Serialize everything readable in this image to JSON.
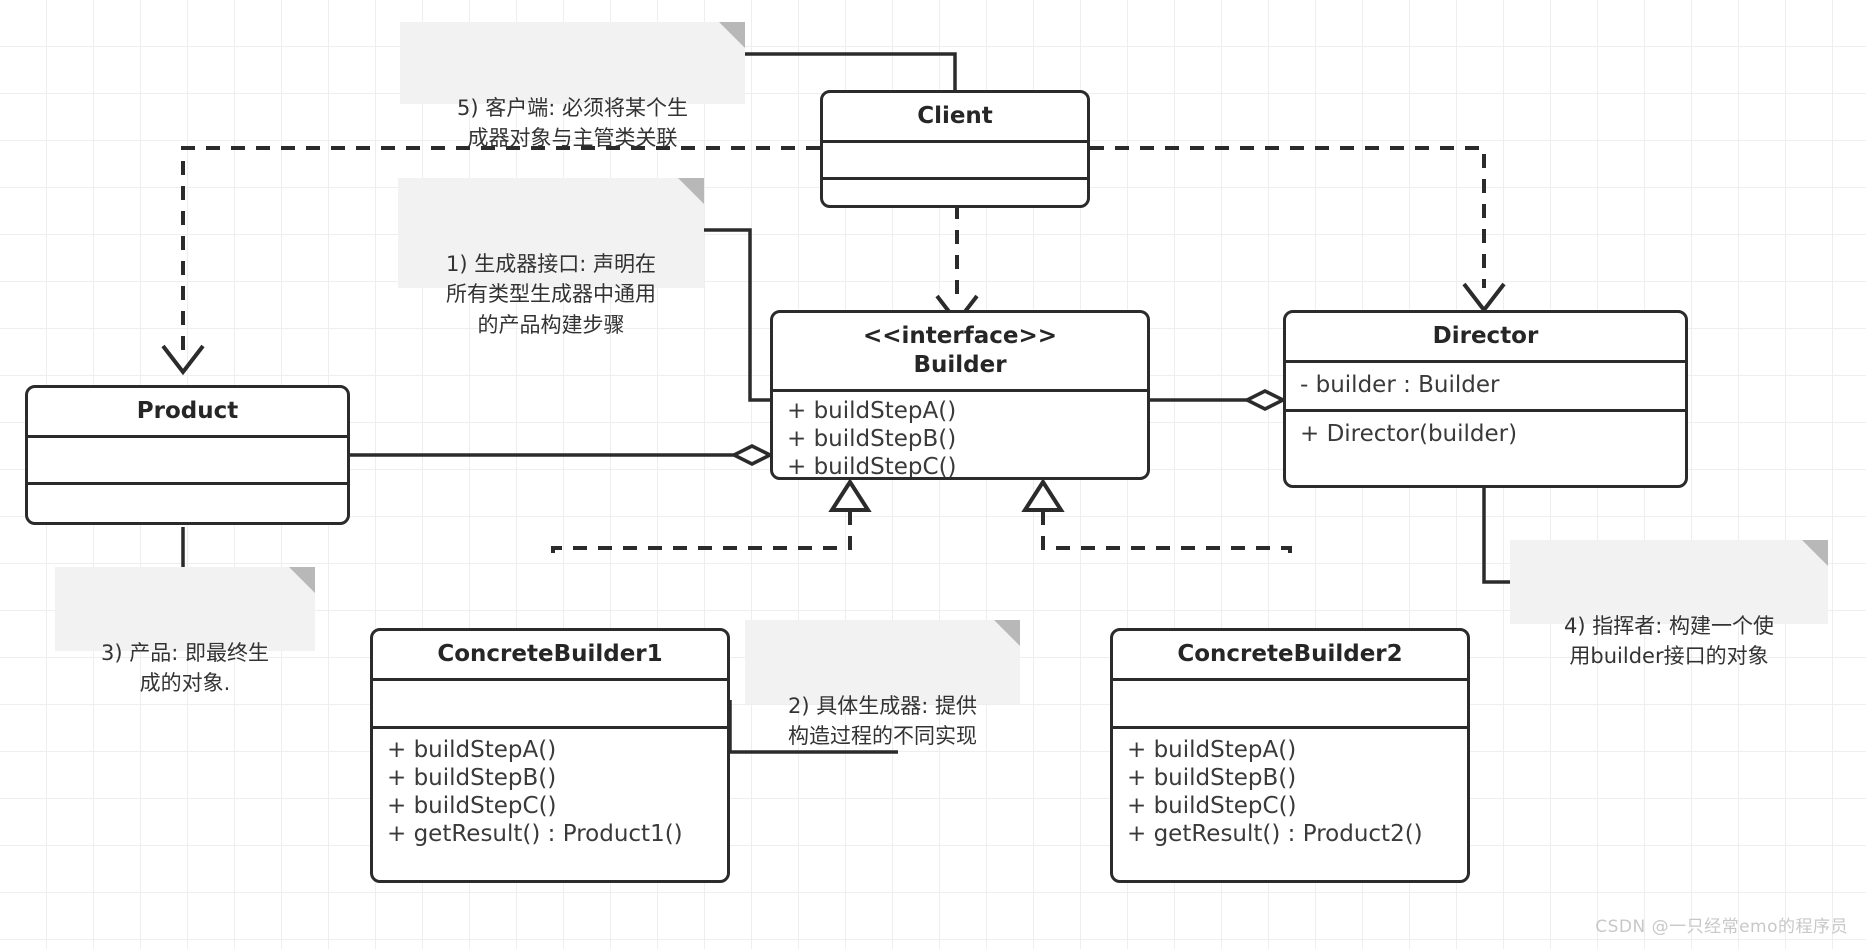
{
  "diagram": {
    "title": "Builder Pattern UML Class Diagram",
    "watermark": "CSDN @一只经常emo的程序员",
    "colors": {
      "stroke": "#2b2b2b",
      "note_bg": "#f2f2f2",
      "note_fold": "#b8b8b8",
      "grid": "#eeeeee",
      "box_bg": "#ffffff"
    }
  },
  "classes": {
    "client": {
      "name": "Client",
      "attributes": [],
      "methods": []
    },
    "builder": {
      "stereotype": "<<interface>>",
      "name": "Builder",
      "title": "<<interface>>\nBuilder",
      "attributes": [],
      "methods": [
        "+ buildStepA()",
        "+ buildStepB()",
        "+ buildStepC()"
      ]
    },
    "director": {
      "name": "Director",
      "attributes": [
        "- builder : Builder"
      ],
      "methods": [
        "+ Director(builder)"
      ]
    },
    "product": {
      "name": "Product",
      "attributes": [],
      "methods": []
    },
    "concrete_builder_1": {
      "name": "ConcreteBuilder1",
      "attributes": [],
      "methods": [
        "+ buildStepA()",
        "+ buildStepB()",
        "+ buildStepC()",
        "+ getResult() : Product1()"
      ]
    },
    "concrete_builder_2": {
      "name": "ConcreteBuilder2",
      "attributes": [],
      "methods": [
        "+ buildStepA()",
        "+ buildStepB()",
        "+ buildStepC()",
        "+ getResult() : Product2()"
      ]
    }
  },
  "notes": {
    "note1": "1) 生成器接口: 声明在\n所有类型生成器中通用\n的产品构建步骤",
    "note2": "2) 具体生成器: 提供\n构造过程的不同实现",
    "note3": "3) 产品: 即最终生\n成的对象.",
    "note4": "4) 指挥者: 构建一个使\n用builder接口的对象",
    "note5": "5) 客户端: 必须将某个生\n成器对象与主管类关联"
  }
}
